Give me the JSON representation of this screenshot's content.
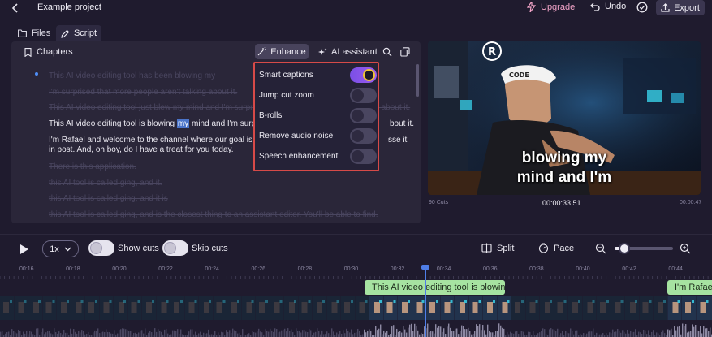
{
  "header": {
    "project_title": "Example project",
    "upgrade_label": "Upgrade",
    "undo_label": "Undo",
    "export_label": "Export"
  },
  "tabs": [
    {
      "label": "Files",
      "icon": "folder-icon"
    },
    {
      "label": "Script",
      "icon": "pencil-icon",
      "active": true
    }
  ],
  "script_panel": {
    "chapters_label": "Chapters",
    "enhance_label": "Enhance",
    "ai_assistant_label": "AI assistant",
    "lines": [
      {
        "text": "This AI video editing tool has been blowing my",
        "struck": true
      },
      {
        "text": "I'm surprised that more people aren't talking about it.",
        "struck": true
      },
      {
        "text": "This AI video editing tool just blew my mind and I'm surprised that more people aren't talking about it.",
        "struck": true
      },
      {
        "pre": "This AI video editing tool is blowing ",
        "highlight": "my",
        "post": " mind and I'm surpris",
        "tail": "bout it."
      },
      {
        "text": "I'm Rafael and welcome to the channel where our goal is to",
        "tail": "sse it"
      },
      {
        "text": "in post. And, oh boy, do I have a treat for you today."
      },
      {
        "text": "There is this application.",
        "struck": true
      },
      {
        "text": "this AI tool is called ging, and it.",
        "struck": true
      },
      {
        "text": "this AI tool is called ging, and it is",
        "struck": true
      },
      {
        "text": "this AI tool is called ging, and is the closest thing to an assistant editor. You'll be able to find.",
        "struck": true
      }
    ]
  },
  "enhance_menu": {
    "options": [
      {
        "label": "Smart captions",
        "on": true
      },
      {
        "label": "Jump cut zoom",
        "on": false
      },
      {
        "label": "B-rolls",
        "on": false
      },
      {
        "label": "Remove audio noise",
        "on": false
      },
      {
        "label": "Speech enhancement",
        "on": false
      }
    ],
    "highlight_color": "#d64a48",
    "toggle_on_color": "#8a55ec"
  },
  "video": {
    "caption_line1": "blowing my",
    "caption_line2": "mind and I'm",
    "cap_text": "CODE",
    "logo_text": "R",
    "start_time": "90 Cuts",
    "current_time": "00:00:33.51",
    "end_time": "00:00:47"
  },
  "controls": {
    "speed": "1x",
    "show_cuts_label": "Show cuts",
    "skip_cuts_label": "Skip cuts",
    "split_label": "Split",
    "pace_label": "Pace",
    "zoom_level": 0.15
  },
  "timeline": {
    "ticks": [
      "00:16",
      "00:18",
      "00:20",
      "00:22",
      "00:24",
      "00:26",
      "00:28",
      "00:30",
      "00:32",
      "00:34",
      "00:36",
      "00:38",
      "00:40",
      "00:42",
      "00:44"
    ],
    "clips": [
      {
        "label": "This AI video editing tool is blowin..."
      },
      {
        "label": "I'm Rafael a"
      }
    ],
    "playhead_time": "00:33.51",
    "clip_color": "#a6e3a1"
  }
}
